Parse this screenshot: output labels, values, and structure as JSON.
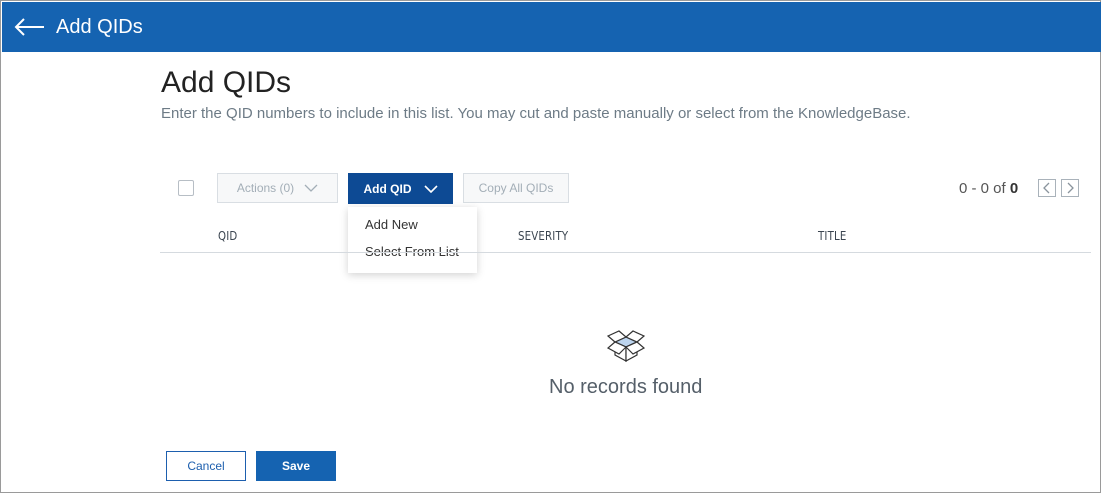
{
  "header": {
    "title": "Add QIDs",
    "back_icon": "arrow-left-icon"
  },
  "main": {
    "title": "Add QIDs",
    "description": "Enter the QID numbers to include in this list. You may cut and paste manually or select from the KnowledgeBase."
  },
  "toolbar": {
    "actions_label": "Actions (0)",
    "add_qid_label": "Add QID",
    "copy_all_label": "Copy All QIDs",
    "add_qid_menu": [
      "Add New",
      "Select From List"
    ]
  },
  "pager": {
    "range": "0 - 0 of",
    "total": "0"
  },
  "table": {
    "columns": [
      "QID",
      "SEVERITY",
      "TITLE"
    ],
    "empty_message": "No records found",
    "empty_icon": "open-box-icon"
  },
  "footer": {
    "cancel_label": "Cancel",
    "save_label": "Save"
  },
  "colors": {
    "brand_blue": "#1563b1",
    "dark_blue": "#0d4a94"
  }
}
